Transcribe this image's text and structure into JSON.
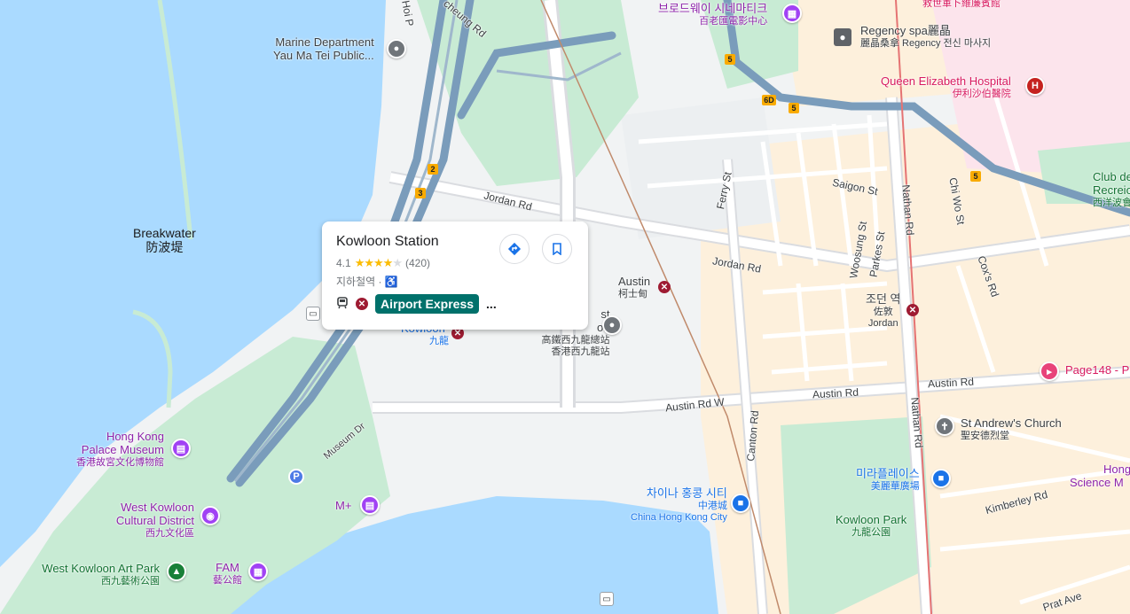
{
  "card": {
    "title": "Kowloon Station",
    "rating": "4.1",
    "review_count": "(420)",
    "category": "지하철역",
    "separator": "·",
    "line_badge": "Airport Express",
    "more": "...",
    "rating_value": 4.1,
    "icons": [
      "directions-icon",
      "save-bookmark-icon",
      "train-icon",
      "mtr-icon",
      "wheelchair-icon"
    ]
  },
  "water_labels": {
    "breakwater_en": "Breakwater",
    "breakwater_zh": "防波堤"
  },
  "roads": {
    "jordan_rd_1": "Jordan Rd",
    "jordan_rd_2": "Jordan Rd",
    "austin_rd_1": "Austin Rd",
    "austin_rd_2": "Austin Rd",
    "austin_rd_w": "Austin Rd W",
    "canton_rd": "Canton Rd",
    "nathan_rd_1": "Nathan Rd",
    "nathan_rd_2": "Nathan Rd",
    "ferry_st": "Ferry St",
    "saigon_st": "Saigon St",
    "woosung_st": "Woosung St",
    "parkes_st": "Parkes St",
    "chi_wo_st": "Chi Wo St",
    "coxs_rd": "Cox's Rd",
    "kimberley_rd": "Kimberley Rd",
    "prat_ave": "Prat Ave",
    "museum_dr": "Museum Dr",
    "hoi_po": "Hoi P",
    "cheung_rd": "cheung Rd"
  },
  "shields": [
    "5",
    "6D",
    "5",
    "5",
    "2",
    "3"
  ],
  "pois": {
    "marine_en": "Marine Department",
    "marine_en2": "Yau Ma Tei Public...",
    "broadway_ko": "브로드웨이 시네마티크",
    "broadway_zh": "百老匯電影中心",
    "regency_en": "Regency spa麗晶",
    "regency_zh": "麗晶桑拿 Regency 전신 마사지",
    "qeh_en": "Queen Elizabeth Hospital",
    "qeh_zh": "伊利沙伯醫院",
    "jiushi_zh": "救世軍卜維廉賓館",
    "club_en": "Club de",
    "club_en2": "Recreio",
    "club_zh": "西洋波會",
    "austin_en": "Austin",
    "austin_zh": "柯士甸",
    "jordan_ko": "조던 역",
    "jordan_zh": "佐敦",
    "jordan_en": "Jordan",
    "kowloon_en": "Kowloon",
    "kowloon_zh": "九龍",
    "terminus_en1": "st",
    "terminus_en2": "on",
    "terminus_zh1": "高鐵西九龍總站",
    "terminus_zh2": "香港西九龍站",
    "page148": "Page148 - P",
    "standrew_en": "St Andrew's Church",
    "standrew_zh": "聖安德烈堂",
    "miramar_ko": "미라플레이스",
    "miramar_zh": "美麗華廣場",
    "science_en1": "Hong",
    "science_en2": "Science M",
    "kowloon_park_en": "Kowloon Park",
    "kowloon_park_zh": "九龍公園",
    "chc_ko": "차이나 홍콩 시티",
    "chc_zh": "中港城",
    "chc_en": "China Hong Kong City",
    "palace_en1": "Hong Kong",
    "palace_en2": "Palace Museum",
    "palace_zh": "香港故宮文化博物館",
    "wkcd_en1": "West Kowloon",
    "wkcd_en2": "Cultural District",
    "wkcd_zh": "西九文化區",
    "mplus": "M+",
    "artpark_en": "West Kowloon Art Park",
    "artpark_zh": "西九藝術公園",
    "fam_en": "FAM",
    "fam_zh": "藝公館",
    "parking": "P"
  },
  "colors": {
    "water": "#aadaff",
    "park": "#c8ebd4",
    "highway": "#7a9cbb",
    "land": "#f1f3f4",
    "urban": "#fdf0dc",
    "mtr": "#9e1b32",
    "express_badge": "#00716b"
  }
}
